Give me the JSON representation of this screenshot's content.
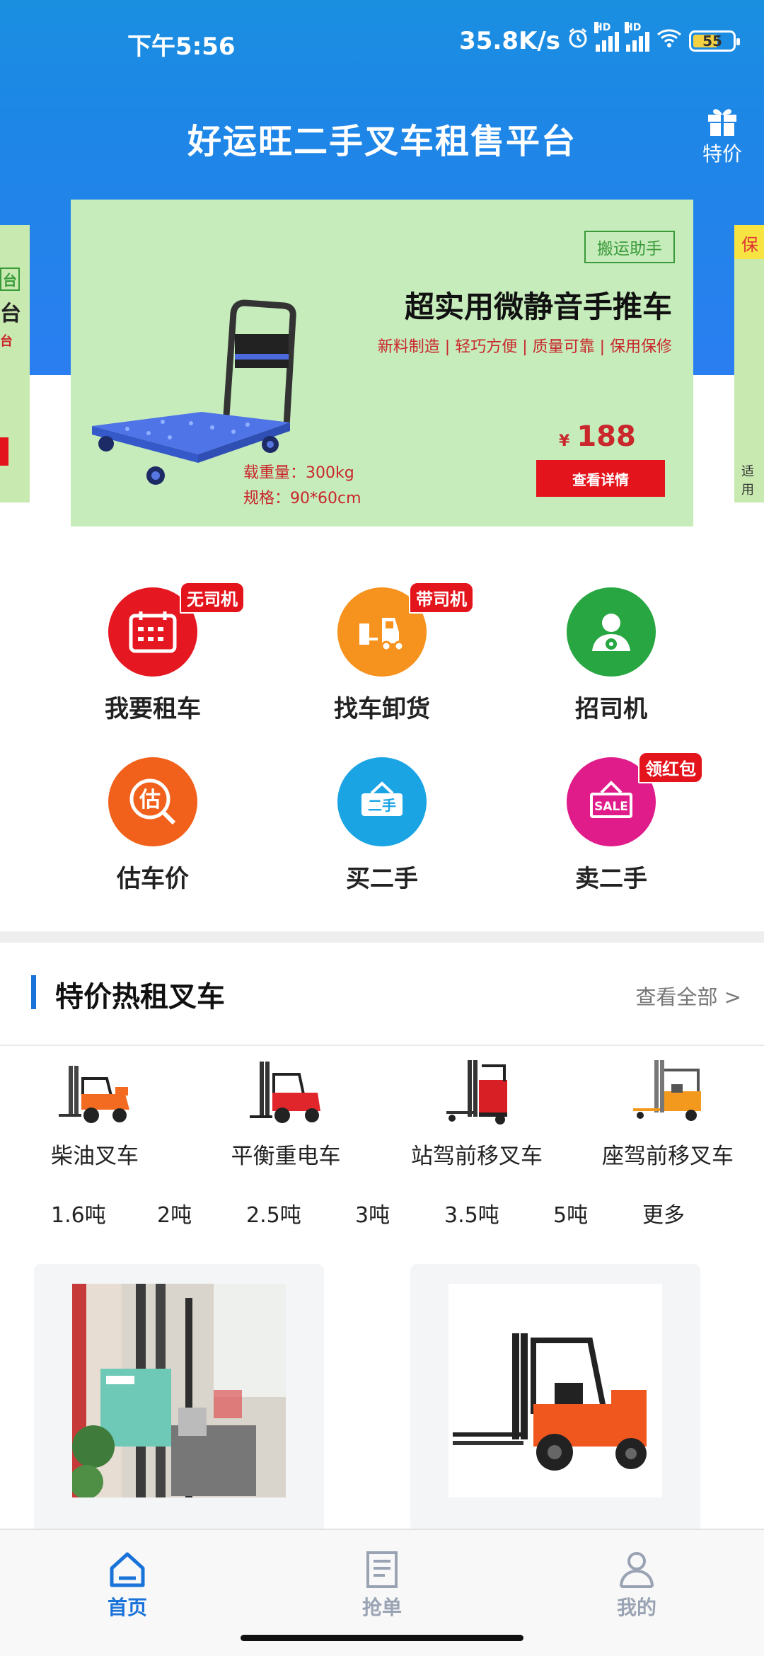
{
  "status_bar": {
    "time": "下午5:56",
    "net_speed": "35.8K/s",
    "hd_label": "HD",
    "wifi_label": "6",
    "battery": "55"
  },
  "header": {
    "title": "好运旺二手叉车租售平台",
    "gift_label": "特价"
  },
  "banner": {
    "tag": "搬运助手",
    "title": "超实用微静音手推车",
    "subtitle": "新料制造 | 轻巧方便 | 质量可靠 | 保用保修",
    "spec_load": "载重量：300kg",
    "spec_size": "规格：90*60cm",
    "price_symbol": "¥",
    "price": "188",
    "detail_button": "查看详情",
    "left_peek": {
      "t1": "台",
      "t2": "台",
      "t3": "台"
    },
    "right_peek": {
      "tag": "保",
      "foot": "适用"
    }
  },
  "shortcuts": [
    {
      "label": "我要租车",
      "badge": "无司机",
      "color": "#e51822"
    },
    {
      "label": "找车卸货",
      "badge": "带司机",
      "color": "#f6921e"
    },
    {
      "label": "招司机",
      "badge": "",
      "color": "#27a642"
    },
    {
      "label": "估车价",
      "badge": "",
      "color": "#f2611b"
    },
    {
      "label": "买二手",
      "badge": "",
      "color": "#1ba4e4"
    },
    {
      "label": "卖二手",
      "badge": "领红包",
      "color": "#e01c8a"
    }
  ],
  "section": {
    "title": "特价热租叉车",
    "view_all": "查看全部 >"
  },
  "categories": [
    {
      "label": "柴油叉车"
    },
    {
      "label": "平衡重电车"
    },
    {
      "label": "站驾前移叉车"
    },
    {
      "label": "座驾前移叉车"
    }
  ],
  "tonnages": [
    "1.6吨",
    "2吨",
    "2.5吨",
    "3吨",
    "3.5吨",
    "5吨",
    "更多"
  ],
  "tabs": [
    {
      "label": "首页"
    },
    {
      "label": "抢单"
    },
    {
      "label": "我的"
    }
  ],
  "colors": {
    "header_blue": "#1d87e6",
    "accent_blue": "#1a73d9",
    "banner_green": "#c6ecbb",
    "price_red": "#c9272c"
  }
}
